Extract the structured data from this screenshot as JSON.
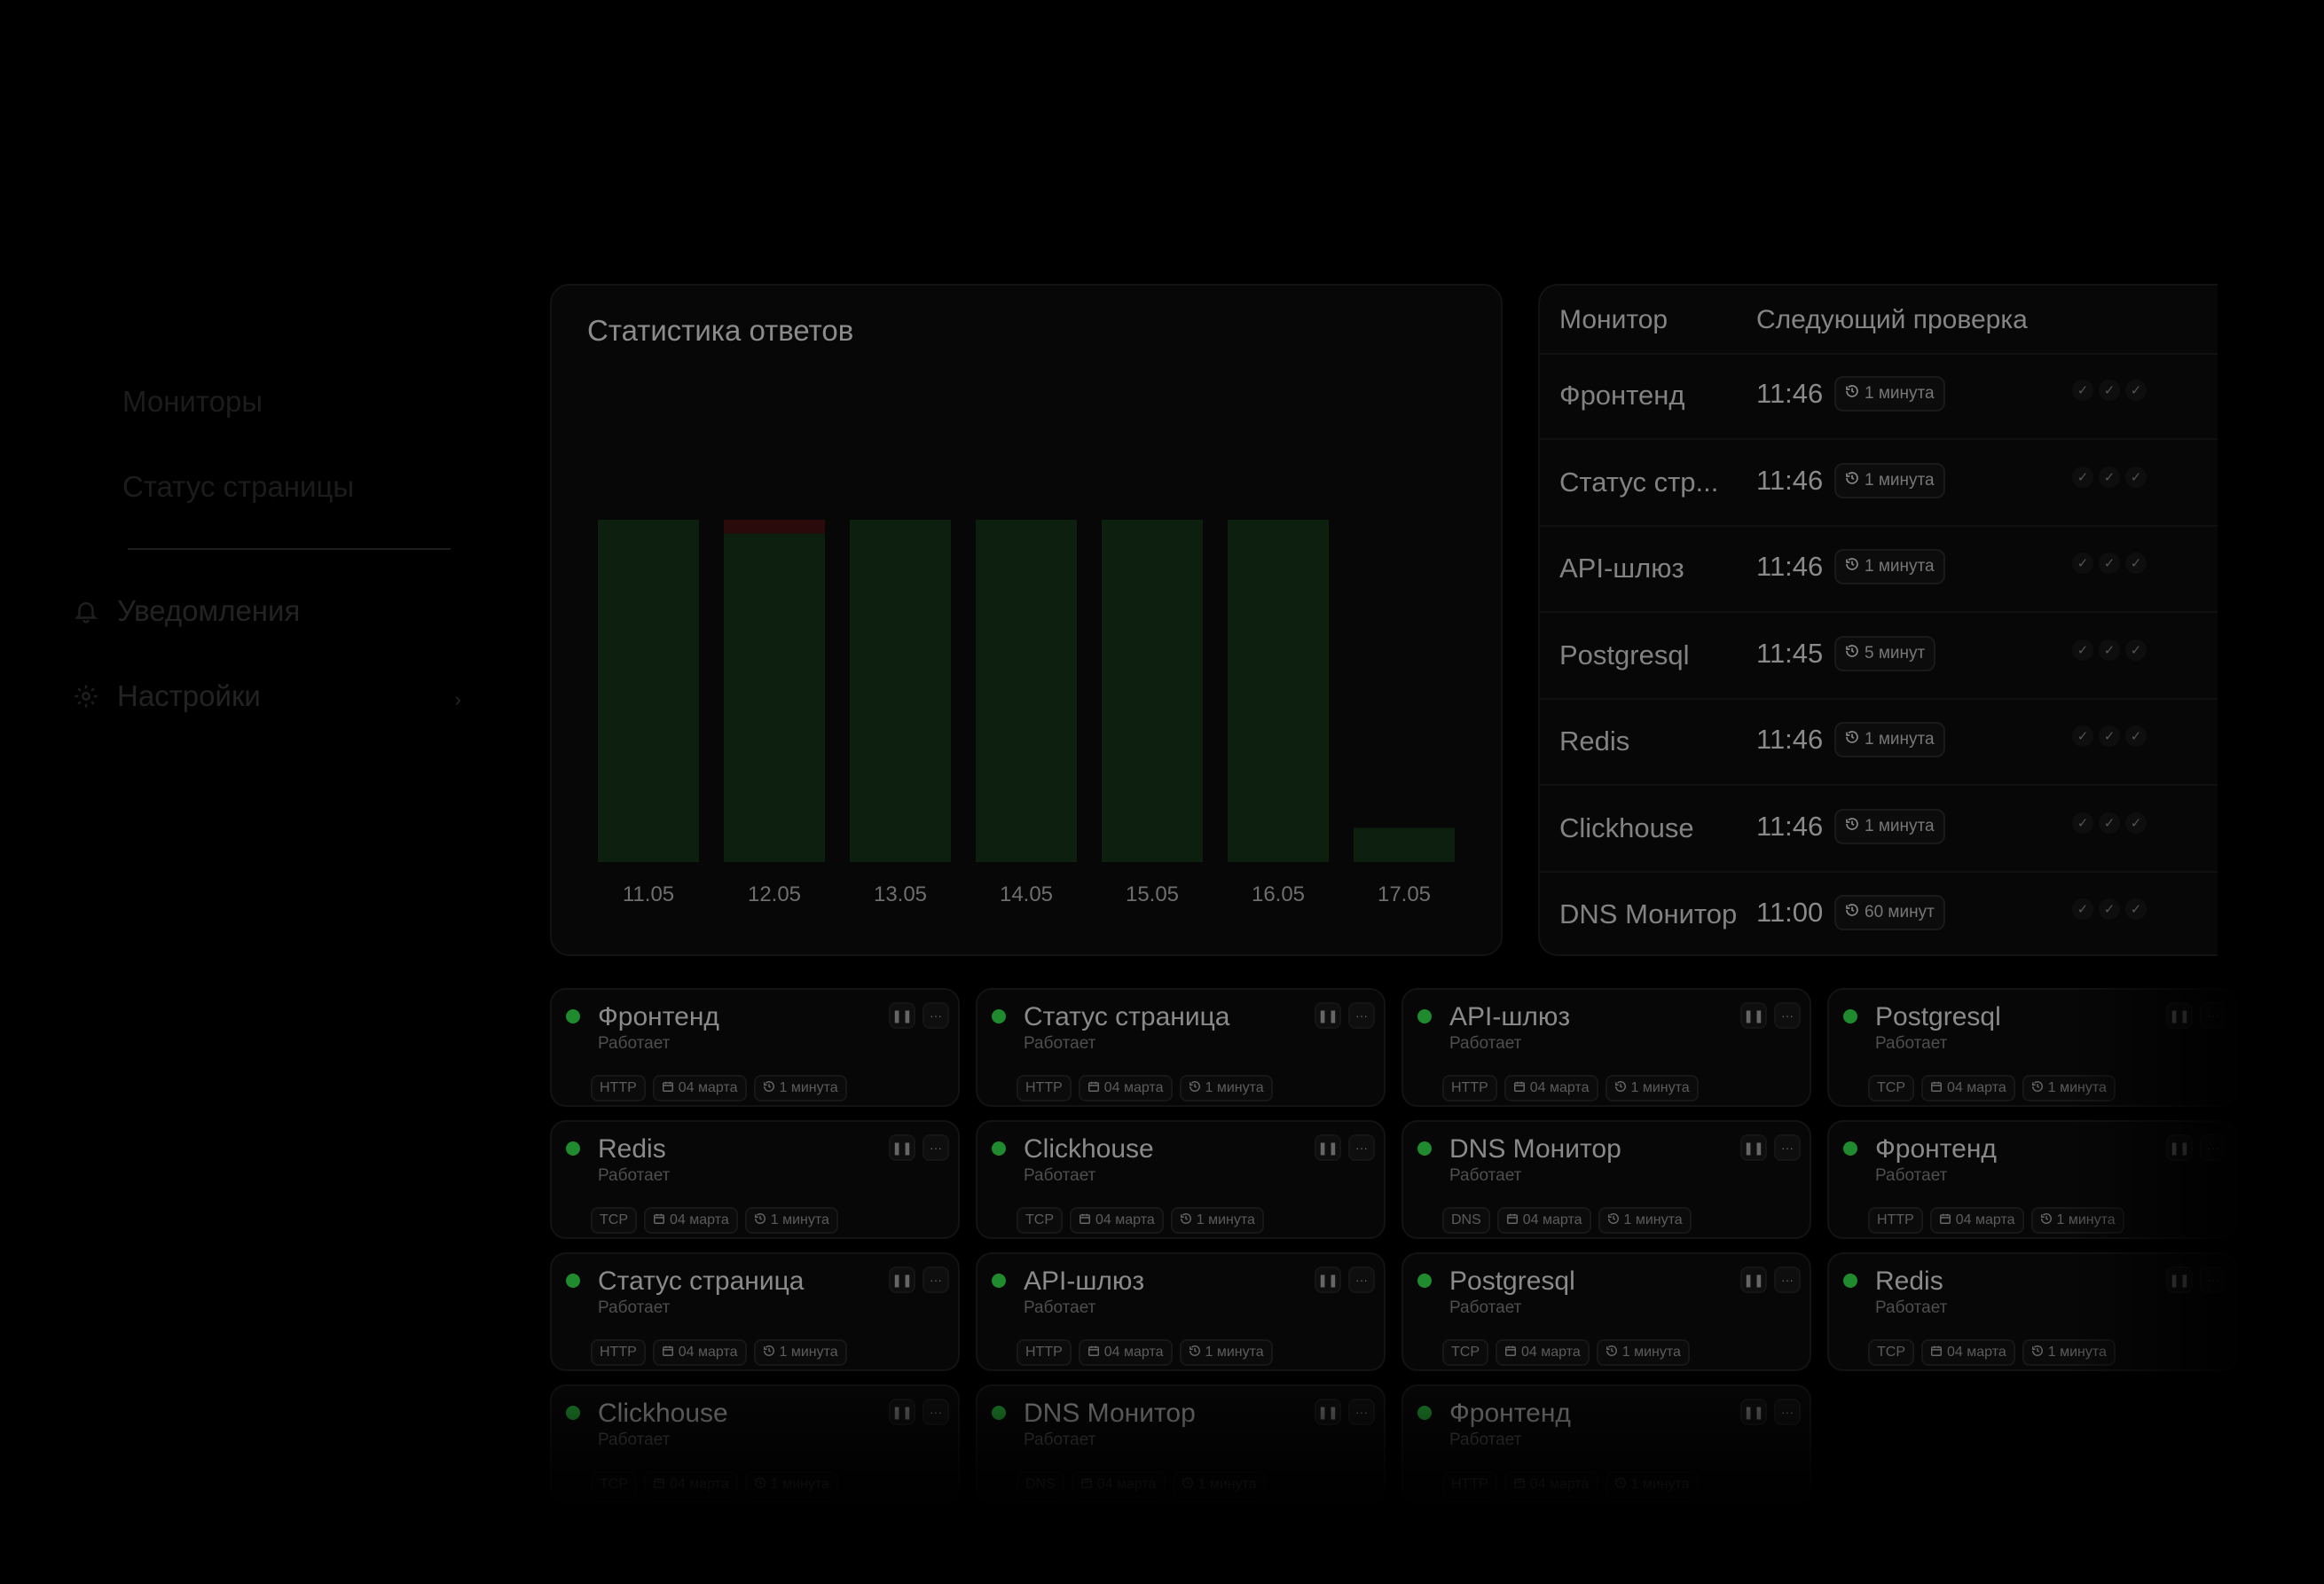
{
  "sidebar": {
    "items": [
      {
        "label": "Мониторы",
        "icon": "monitor-icon"
      },
      {
        "label": "Статус страницы",
        "icon": "none"
      },
      {
        "label": "Уведомления",
        "icon": "bell-icon"
      },
      {
        "label": "Настройки",
        "icon": "gear-icon"
      }
    ],
    "chevron": "›"
  },
  "chart": {
    "title": "Статистика ответов"
  },
  "chart_data": {
    "type": "bar",
    "title": "Статистика ответов",
    "categories": [
      "11.05",
      "12.05",
      "13.05",
      "14.05",
      "15.05",
      "16.05",
      "17.05"
    ],
    "series": [
      {
        "values": [
          100,
          96,
          100,
          100,
          100,
          100,
          10
        ],
        "color": "#0d1f0f"
      },
      {
        "values": [
          0,
          4,
          0,
          0,
          0,
          0,
          0
        ],
        "color": "#2a0a0a"
      }
    ],
    "ylim": [
      0,
      100
    ],
    "grid": false,
    "stacked": true
  },
  "table": {
    "headers": [
      "Монитор",
      "Следующий проверка"
    ],
    "rows": [
      {
        "name": "Фронтенд",
        "time": "11:46",
        "interval": "1 минута"
      },
      {
        "name": "Статус стр...",
        "time": "11:46",
        "interval": "1 минута"
      },
      {
        "name": "API-шлюз",
        "time": "11:46",
        "interval": "1 минута"
      },
      {
        "name": "Postgresql",
        "time": "11:45",
        "interval": "5 минут"
      },
      {
        "name": "Redis",
        "time": "11:46",
        "interval": "1 минута"
      },
      {
        "name": "Clickhouse",
        "time": "11:46",
        "interval": "1 минута"
      },
      {
        "name": "DNS Монитор",
        "time": "11:00",
        "interval": "60 минут"
      }
    ]
  },
  "cards": [
    {
      "name": "Фронтенд",
      "status": "Работает",
      "protocol": "HTTP",
      "date": "04 марта",
      "interval": "1 минута"
    },
    {
      "name": "Статус страница",
      "status": "Работает",
      "protocol": "HTTP",
      "date": "04 марта",
      "interval": "1 минута"
    },
    {
      "name": "API-шлюз",
      "status": "Работает",
      "protocol": "HTTP",
      "date": "04 марта",
      "interval": "1 минута"
    },
    {
      "name": "Postgresql",
      "status": "Работает",
      "protocol": "TCP",
      "date": "04 марта",
      "interval": "1 минута"
    },
    {
      "name": "Redis",
      "status": "Работает",
      "protocol": "TCP",
      "date": "04 марта",
      "interval": "1 минута"
    },
    {
      "name": "Clickhouse",
      "status": "Работает",
      "protocol": "TCP",
      "date": "04 марта",
      "interval": "1 минута"
    },
    {
      "name": "DNS Монитор",
      "status": "Работает",
      "protocol": "DNS",
      "date": "04 марта",
      "interval": "1 минута"
    },
    {
      "name": "Фронтенд",
      "status": "Работает",
      "protocol": "HTTP",
      "date": "04 марта",
      "interval": "1 минута"
    },
    {
      "name": "Статус страница",
      "status": "Работает",
      "protocol": "HTTP",
      "date": "04 марта",
      "interval": "1 минута"
    },
    {
      "name": "API-шлюз",
      "status": "Работает",
      "protocol": "HTTP",
      "date": "04 марта",
      "interval": "1 минута"
    },
    {
      "name": "Postgresql",
      "status": "Работает",
      "protocol": "TCP",
      "date": "04 марта",
      "interval": "1 минута"
    },
    {
      "name": "Redis",
      "status": "Работает",
      "protocol": "TCP",
      "date": "04 марта",
      "interval": "1 минута"
    },
    {
      "name": "Clickhouse",
      "status": "Работает",
      "protocol": "TCP",
      "date": "04 марта",
      "interval": "1 минута"
    },
    {
      "name": "DNS Монитор",
      "status": "Работает",
      "protocol": "DNS",
      "date": "04 марта",
      "interval": "1 минута"
    },
    {
      "name": "Фронтенд",
      "status": "Работает",
      "protocol": "HTTP",
      "date": "04 марта",
      "interval": "1 минута"
    }
  ]
}
